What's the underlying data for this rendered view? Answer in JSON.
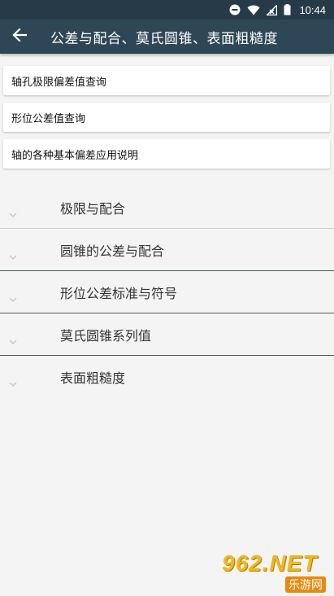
{
  "status_bar": {
    "time": "10:44",
    "icons": [
      "do-not-disturb-icon",
      "wifi-icon",
      "signal-icon",
      "battery-icon"
    ]
  },
  "app_bar": {
    "back_icon": "arrow-left-icon",
    "title": "公差与配合、莫氏圆锥、表面粗糙度"
  },
  "cards": [
    {
      "label": "轴孔极限偏差值查询"
    },
    {
      "label": "形位公差值查询"
    },
    {
      "label": "轴的各种基本偏差应用说明"
    }
  ],
  "accordion": [
    {
      "label": "极限与配合",
      "icon": "chevron-down-icon"
    },
    {
      "label": "圆锥的公差与配合",
      "icon": "chevron-down-icon"
    },
    {
      "label": "形位公差标准与符号",
      "icon": "chevron-down-icon"
    },
    {
      "label": "莫氏圆锥系列值",
      "icon": "chevron-down-icon"
    },
    {
      "label": "表面粗糙度",
      "icon": "chevron-down-icon"
    }
  ],
  "watermark": {
    "logo": "962.NET",
    "sub": "乐游网"
  },
  "colors": {
    "status_bar": "#263a47",
    "app_bar": "#2e4756",
    "background": "#f4f4f4"
  }
}
